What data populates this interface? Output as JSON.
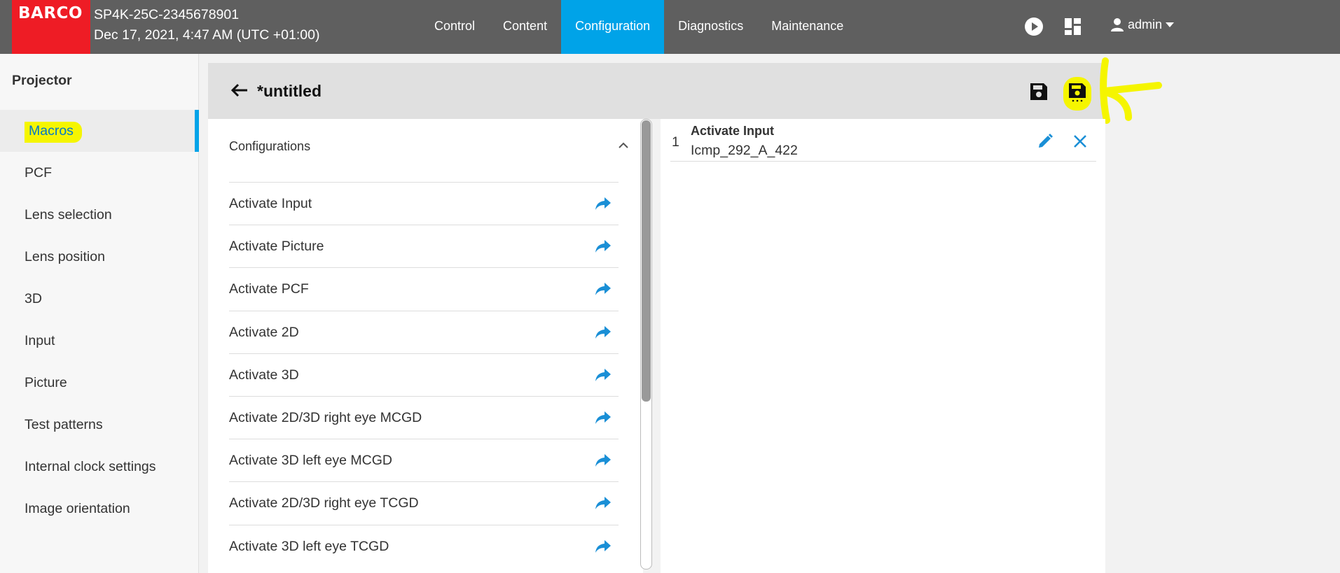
{
  "header": {
    "logo": "BARCO",
    "device_name": "SP4K-25C-2345678901",
    "datetime": "Dec 17, 2021, 4:47 AM (UTC +01:00)",
    "nav": [
      "Control",
      "Content",
      "Configuration",
      "Diagnostics",
      "Maintenance"
    ],
    "active_nav": "Configuration",
    "user": "admin",
    "icons": [
      "play-icon",
      "dashboard-icon",
      "person-icon",
      "caret-down-icon"
    ],
    "accent_color": "#00a3e8",
    "brand_color": "#ee1c25"
  },
  "sidebar": {
    "title": "Projector",
    "items": [
      "Macros",
      "PCF",
      "Lens selection",
      "Lens position",
      "3D",
      "Input",
      "Picture",
      "Test patterns",
      "Internal clock settings",
      "Image orientation"
    ],
    "active": "Macros"
  },
  "editor": {
    "title": "*untitled",
    "icons": [
      "back-arrow-icon",
      "save-icon",
      "save-as-icon"
    ],
    "configurations": {
      "title": "Configurations",
      "items": [
        "Activate Input",
        "Activate Picture",
        "Activate PCF",
        "Activate 2D",
        "Activate 3D",
        "Activate 2D/3D right eye MCGD",
        "Activate 3D left eye MCGD",
        "Activate 2D/3D right eye TCGD",
        "Activate 3D left eye TCGD"
      ]
    },
    "macro_steps": [
      {
        "index": "1",
        "name": "Activate Input",
        "value": "Icmp_292_A_422"
      }
    ],
    "highlight_color": "#f5f500"
  }
}
